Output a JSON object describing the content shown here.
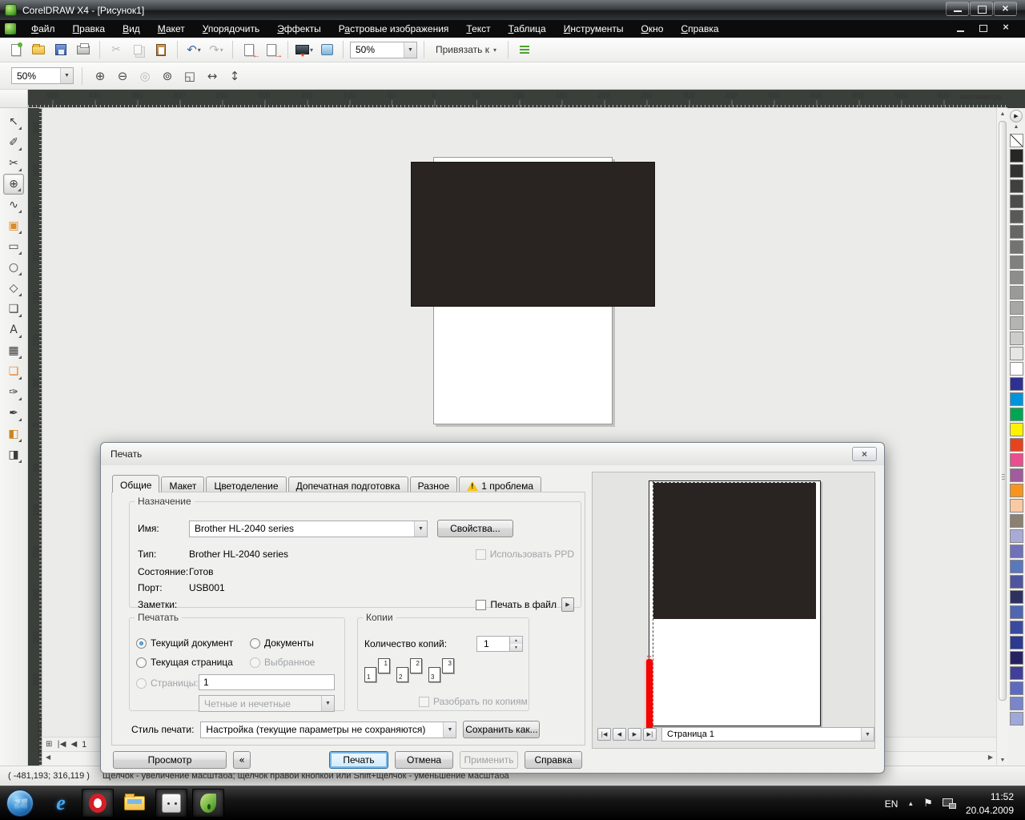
{
  "window": {
    "title": "CorelDRAW X4 - [Рисунок1]",
    "menus": [
      {
        "label": "Файл",
        "accel": 0
      },
      {
        "label": "Правка",
        "accel": 0
      },
      {
        "label": "Вид",
        "accel": 0
      },
      {
        "label": "Макет",
        "accel": 0
      },
      {
        "label": "Упорядочить",
        "accel": 0
      },
      {
        "label": "Эффекты",
        "accel": 0
      },
      {
        "label": "Растровые изображения",
        "accel": 1
      },
      {
        "label": "Текст",
        "accel": 0
      },
      {
        "label": "Таблица",
        "accel": 0
      },
      {
        "label": "Инструменты",
        "accel": 0
      },
      {
        "label": "Окно",
        "accel": 0
      },
      {
        "label": "Справка",
        "accel": 0
      }
    ],
    "toolbar": {
      "zoom_value": "50%",
      "snap_label": "Привязать к"
    },
    "propbar": {
      "zoom_value": "50%",
      "buttons": [
        {
          "name": "zoom-in-icon",
          "glyph": "⊕"
        },
        {
          "name": "zoom-out-icon",
          "glyph": "⊖"
        },
        {
          "name": "zoom-selected-icon",
          "glyph": "◎",
          "disabled": true
        },
        {
          "name": "zoom-all-objects-icon",
          "glyph": "⊚"
        },
        {
          "name": "zoom-page-icon",
          "glyph": "◱"
        },
        {
          "name": "zoom-page-width-icon",
          "glyph": "↔"
        },
        {
          "name": "zoom-page-height-icon",
          "glyph": "↕"
        }
      ]
    },
    "h_ruler": [
      "450",
      "400",
      "350",
      "300",
      "250",
      "200",
      "150",
      "100",
      "50",
      "0",
      "50",
      "100",
      "150",
      "200",
      "250",
      "300",
      "350",
      "400",
      "450",
      "500",
      "550",
      "600"
    ],
    "v_ruler": [
      "350",
      "300",
      "250",
      "200",
      "150",
      "100",
      "50",
      "0",
      "50",
      "100",
      "150",
      "200",
      "250",
      "300"
    ],
    "ruler_unit": "миллиметры",
    "toolbox": [
      {
        "name": "pick-tool",
        "glyph": "↖"
      },
      {
        "name": "shape-tool",
        "glyph": "✐"
      },
      {
        "name": "crop-tool",
        "glyph": "✂"
      },
      {
        "name": "zoom-tool",
        "glyph": "⊕",
        "active": true
      },
      {
        "name": "freehand-tool",
        "glyph": "∿"
      },
      {
        "name": "smart-fill-tool",
        "glyph": "▣",
        "color": "#d98b2b"
      },
      {
        "name": "rectangle-tool",
        "glyph": "▭"
      },
      {
        "name": "ellipse-tool",
        "glyph": "○"
      },
      {
        "name": "polygon-tool",
        "glyph": "◇"
      },
      {
        "name": "basic-shapes-tool",
        "glyph": "❑"
      },
      {
        "name": "text-tool",
        "glyph": "A"
      },
      {
        "name": "table-tool",
        "glyph": "▦"
      },
      {
        "name": "interactive-tool",
        "glyph": "❏",
        "color": "#e8822a"
      },
      {
        "name": "eyedropper-tool",
        "glyph": "✑"
      },
      {
        "name": "outline-pen-tool",
        "glyph": "✒"
      },
      {
        "name": "fill-tool",
        "glyph": "◧",
        "color": "#c9851f"
      },
      {
        "name": "interactive-fill-tool",
        "glyph": "◨"
      }
    ],
    "page_nav": {
      "page": "1"
    },
    "status": {
      "coords": "( -481,193; 316,119 )",
      "hint": "Щелчок - увеличение масштаба; щелчок правой кнопкой или Shift+щелчок - уменьшение масштаба"
    }
  },
  "canvas": {
    "object_color": "#292421"
  },
  "palette": {
    "colors": [
      "#262626",
      "#333333",
      "#404040",
      "#4d4d4d",
      "#595959",
      "#666666",
      "#737373",
      "#808080",
      "#8d8d8d",
      "#9a9a9a",
      "#a7a7a7",
      "#b4b4b4",
      "#cccccc",
      "#e6e6e6",
      "#ffffff",
      "#2e3192",
      "#0093dd",
      "#00a651",
      "#fff200",
      "#e8431f",
      "#e94e8f",
      "#a05c9c",
      "#f7941d",
      "#f9c9a3",
      "#8c8072",
      "#a9aad6",
      "#6f71b9",
      "#5a78bb",
      "#50549e",
      "#2e3160",
      "#4f66b0",
      "#3a4a9f",
      "#2b3990",
      "#262262",
      "#40409a",
      "#5c6bc0",
      "#7986cb",
      "#9fa8da"
    ]
  },
  "icons": {
    "first_page": "|◀",
    "prev_page": "◀",
    "next_page": "▶",
    "last_page": "▶|",
    "flyout_right": "▶",
    "back": "«",
    "close": "×",
    "add_page": "⊞",
    "left": "◀",
    "right": "▶",
    "up": "▲",
    "down": "▼",
    "flag": "⚑"
  },
  "dialog": {
    "title": "Печать",
    "tabs": [
      {
        "label": "Общие",
        "active": true
      },
      {
        "label": "Макет"
      },
      {
        "label": "Цветоделение"
      },
      {
        "label": "Допечатная подготовка"
      },
      {
        "label": "Разное"
      },
      {
        "label": "1 проблема",
        "warning": true
      }
    ],
    "destination": {
      "legend": "Назначение",
      "name_label": "Имя:",
      "name_value": "Brother HL-2040 series",
      "properties_button": "Свойства...",
      "type_label": "Тип:",
      "type_value": "Brother HL-2040 series",
      "use_ppd_label": "Использовать PPD",
      "state_label": "Состояние:",
      "state_value": "Готов",
      "port_label": "Порт:",
      "port_value": "USB001",
      "notes_label": "Заметки:",
      "print_to_file_label": "Печать в файл"
    },
    "print_range": {
      "legend": "Печатать",
      "current_document": "Текущий документ",
      "documents": "Документы",
      "current_page": "Текущая страница",
      "selection": "Выбранное",
      "pages_label": "Страницы:",
      "pages_value": "1",
      "even_odd_value": "Четные и нечетные"
    },
    "copies": {
      "legend": "Копии",
      "count_label": "Количество копий:",
      "count_value": "1",
      "collate_numbers": [
        "1",
        "2",
        "3"
      ],
      "collate_label": "Разобрать по копиям"
    },
    "style": {
      "label": "Стиль печати:",
      "value": "Настройка (текущие параметры не сохраняются)",
      "save_as_button": "Сохранить как..."
    },
    "preview": {
      "page_select": "Страница 1"
    },
    "buttons": {
      "preview": "Просмотр",
      "print": "Печать",
      "cancel": "Отмена",
      "apply": "Применить",
      "help": "Справка"
    }
  },
  "taskbar": {
    "lang": "EN",
    "time": "11:52",
    "date": "20.04.2009"
  }
}
